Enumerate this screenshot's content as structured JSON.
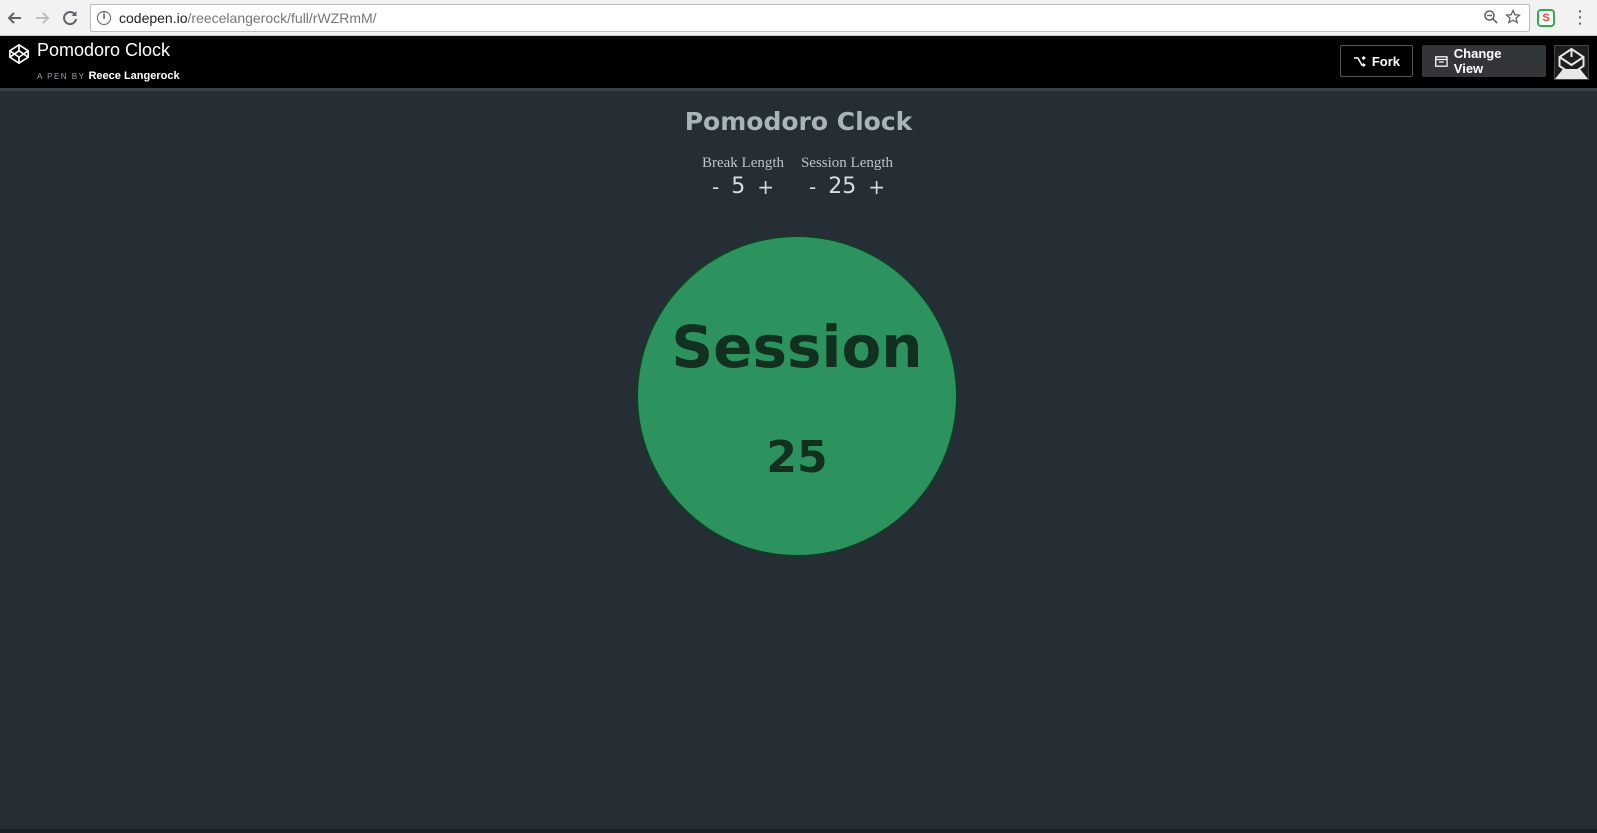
{
  "browser": {
    "url_host": "codepen.io",
    "url_path": "/reecelangerock/full/rWZRmM/",
    "back_icon": "arrow-left-icon",
    "forward_icon": "arrow-right-icon",
    "reload_icon": "reload-icon",
    "extension_label": "S"
  },
  "codepen": {
    "title": "Pomodoro Clock",
    "byline_prefix": "A PEN BY",
    "author": "Reece Langerock",
    "fork_label": "Fork",
    "change_view_label": "Change View"
  },
  "app": {
    "title": "Pomodoro Clock",
    "break": {
      "label": "Break Length",
      "minus": "-",
      "value": "5",
      "plus": "+"
    },
    "session": {
      "label": "Session Length",
      "minus": "-",
      "value": "25",
      "plus": "+"
    },
    "clock": {
      "label": "Session",
      "time": "25"
    }
  },
  "colors": {
    "page_bg": "#252e35",
    "clock_fill": "#2c935e",
    "clock_text": "#12301f",
    "title_text": "#a8b4bc"
  }
}
